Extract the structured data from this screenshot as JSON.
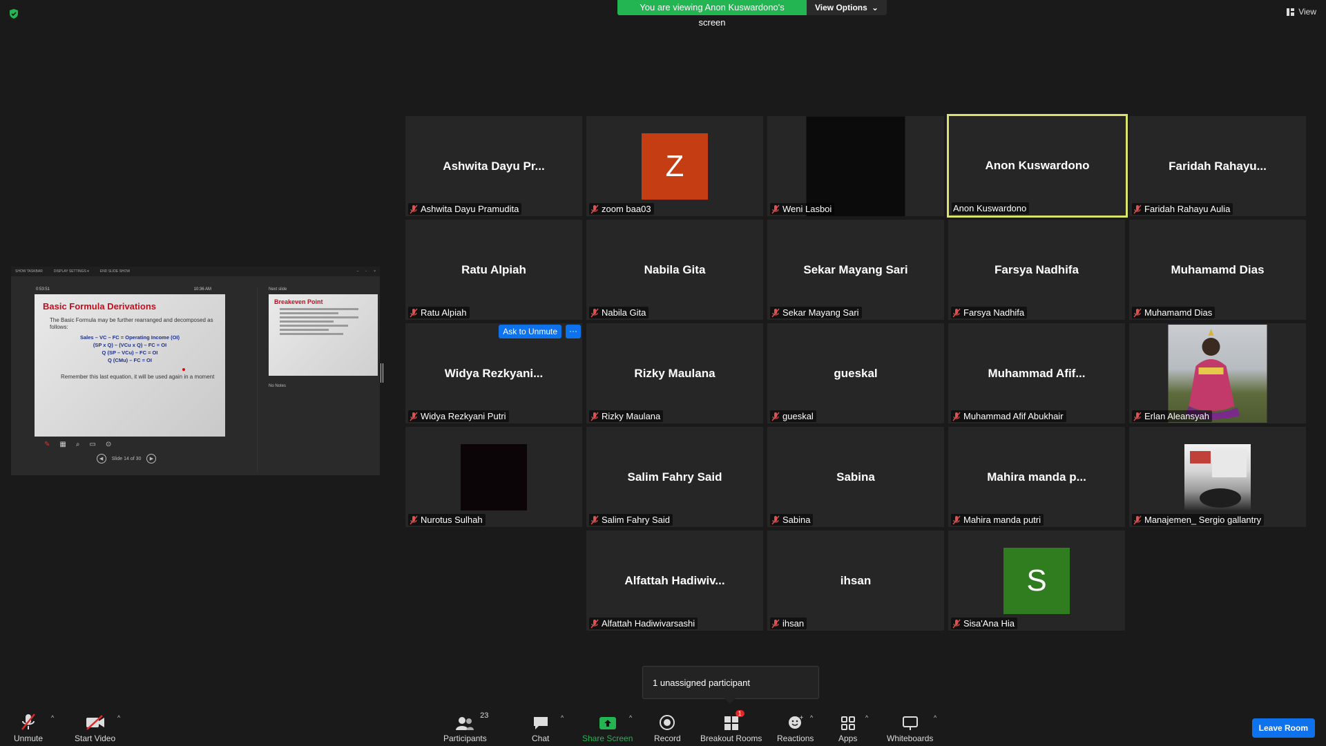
{
  "banner": {
    "viewing_text": "You are viewing Anon Kuswardono's screen",
    "view_options": "View Options"
  },
  "top_view_label": "View",
  "shared_screen": {
    "taskbar_items": [
      "SHOW TASKBAR",
      "DISPLAY SETTINGS ▾",
      "END SLIDE SHOW"
    ],
    "elapsed": "0:53:51",
    "clock": "10:36 AM",
    "slide_title": "Basic Formula Derivations",
    "slide_bullet": "The Basic Formula may be further rearranged and decomposed as follows:",
    "slide_equations": [
      "Sales – VC – FC = Operating Income (OI)",
      "(SP x Q) – (VCu x Q) – FC = OI",
      "Q (SP – VCu) – FC = OI",
      "Q (CMu) – FC = OI"
    ],
    "slide_remember": "Remember this last equation, it will be used again in a moment",
    "slide_counter": "Slide 14 of 30",
    "next_label": "Next slide",
    "next_title": "Breakeven Point",
    "notes": "No Notes"
  },
  "tiles": [
    {
      "display": "Ashwita Dayu Pr...",
      "label": "Ashwita Dayu Pramudita",
      "muted": true
    },
    {
      "display": "",
      "avatar": "Z",
      "avatar_color": "#c53d13",
      "label": "zoom baa03",
      "muted": true
    },
    {
      "display": "",
      "video": "dark",
      "label": "Weni Lasboi",
      "muted": true
    },
    {
      "display": "Anon Kuswardono",
      "label": "Anon Kuswardono",
      "muted": false,
      "active": true
    },
    {
      "display": "Faridah  Rahayu...",
      "label": "Faridah Rahayu Aulia",
      "muted": true
    },
    {
      "display": "Ratu Alpiah",
      "label": "Ratu Alpiah",
      "muted": true
    },
    {
      "display": "Nabila Gita",
      "label": "Nabila Gita",
      "muted": true
    },
    {
      "display": "Sekar Mayang Sari",
      "label": "Sekar Mayang Sari",
      "muted": true
    },
    {
      "display": "Farsya Nadhifa",
      "label": "Farsya Nadhifa",
      "muted": true
    },
    {
      "display": "Muhamamd Dias",
      "label": "Muhamamd Dias",
      "muted": true
    },
    {
      "display": "Widya  Rezkyani...",
      "label": "Widya Rezkyani Putri",
      "muted": true,
      "ask_unmute": "Ask to Unmute"
    },
    {
      "display": "Rizky Maulana",
      "label": "Rizky Maulana",
      "muted": true
    },
    {
      "display": "gueskal",
      "label": "gueskal",
      "muted": true
    },
    {
      "display": "Muhammad  Afif...",
      "label": "Muhammad Afif Abukhair",
      "muted": true
    },
    {
      "display": "",
      "video": "photo-person",
      "label": "Erlan Aleansyah",
      "muted": true
    },
    {
      "display": "",
      "video": "black",
      "label": "Nurotus Sulhah",
      "muted": true
    },
    {
      "display": "Salim Fahry Said",
      "label": "Salim Fahry Said",
      "muted": true
    },
    {
      "display": "Sabina",
      "label": "Sabina",
      "muted": true
    },
    {
      "display": "Mahira manda p...",
      "label": "Mahira manda putri",
      "muted": true
    },
    {
      "display": "",
      "video": "photo-room",
      "label": "Manajemen_ Sergio gallantry",
      "muted": true
    },
    {
      "display": "Alfattah  Hadiwiv...",
      "label": "Alfattah Hadiwivarsashi",
      "muted": true
    },
    {
      "display": "ihsan",
      "label": "ihsan",
      "muted": true
    },
    {
      "display": "",
      "avatar": "S",
      "avatar_color": "#2f7d1f",
      "label": "Sisa'Ana Hia",
      "muted": true
    }
  ],
  "tooltip": "1 unassigned participant",
  "toolbar": {
    "unmute": "Unmute",
    "start_video": "Start Video",
    "participants": "Participants",
    "participants_count": "23",
    "chat": "Chat",
    "share_screen": "Share Screen",
    "record": "Record",
    "breakout_rooms": "Breakout Rooms",
    "breakout_badge": "1",
    "reactions": "Reactions",
    "apps": "Apps",
    "whiteboards": "Whiteboards",
    "leave_room": "Leave Room"
  },
  "colors": {
    "accent": "#0e72ed",
    "share_green": "#23b551",
    "active_speaker": "#d9e56a",
    "mute_red": "#e02828"
  }
}
